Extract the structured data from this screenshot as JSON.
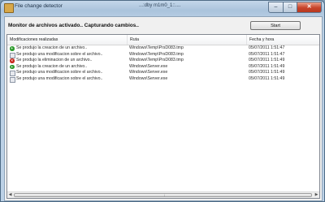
{
  "window": {
    "title": "File change detector",
    "title_center": "...:dby m1m0_1::....",
    "controls": {
      "minimize": "–",
      "maximize": "□",
      "close": "✕"
    },
    "icon": "folder-app-icon"
  },
  "toolbar": {
    "status_text": "Monitor de archivos activado.. Capturando cambios..",
    "start_label": "Start"
  },
  "list": {
    "columns": [
      "Modificaciones realizadas",
      "Ruta",
      "Fecha y hora"
    ],
    "rows": [
      {
        "icon": "add-icon",
        "message": "Se produjo la creacion de un archivo..",
        "path": "Windows\\Temp\\PrsD083.tmp",
        "datetime": "05/07/2011 1:51:47"
      },
      {
        "icon": "modify-icon",
        "message": "Se produjo una modificacion sobre el archivo..",
        "path": "Windows\\Temp\\PrsD083.tmp",
        "datetime": "05/07/2011 1:51:47"
      },
      {
        "icon": "delete-icon",
        "message": "Se produjo la eliminacion de un archivo..",
        "path": "Windows\\Temp\\PrsD083.tmp",
        "datetime": "05/07/2011 1:51:49"
      },
      {
        "icon": "add-icon",
        "message": "Se produjo la creacion de un archivo..",
        "path": "Windows\\Server.exe",
        "datetime": "05/07/2011 1:51:49"
      },
      {
        "icon": "modify-icon",
        "message": "Se produjo una modificacion sobre el archivo..",
        "path": "Windows\\Server.exe",
        "datetime": "05/07/2011 1:51:49"
      },
      {
        "icon": "modify-icon",
        "message": "Se produjo una modificacion sobre el archivo..",
        "path": "Windows\\Server.exe",
        "datetime": "05/07/2011 1:51:49"
      }
    ]
  },
  "colors": {
    "add": "#2d9b2d",
    "delete": "#c9271d",
    "titlebar": "#aac3dc"
  }
}
